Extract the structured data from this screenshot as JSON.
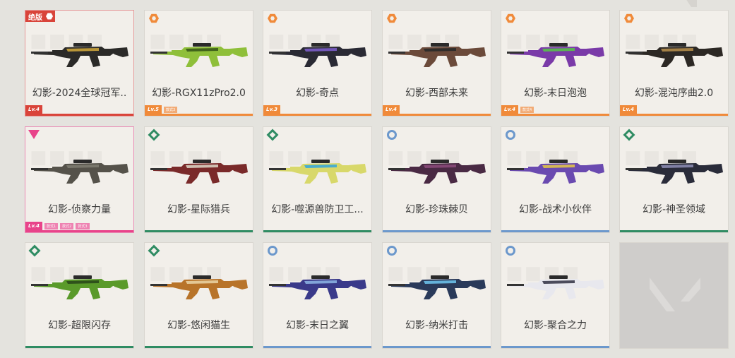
{
  "cards": [
    {
      "name": "幻影-2024全球冠军..",
      "rarity": "red",
      "badge": "red-label",
      "badge_text": "绝版",
      "level": "Lv.4",
      "chips": [],
      "gun_color": "#2b2a28",
      "accent": "#c9a23a"
    },
    {
      "name": "幻影-RGX11zPro2.0",
      "rarity": "orange",
      "badge": "hex",
      "level": "Lv.5",
      "chips": [
        "款式3"
      ],
      "gun_color": "#8fbf3a",
      "accent": "#3a5a1a"
    },
    {
      "name": "幻影-奇点",
      "rarity": "orange",
      "badge": "hex",
      "level": "Lv.3",
      "chips": [],
      "gun_color": "#2a2a34",
      "accent": "#7a5cc6"
    },
    {
      "name": "幻影-西部未来",
      "rarity": "orange",
      "badge": "hex",
      "level": "Lv.4",
      "chips": [],
      "gun_color": "#6b4a3a",
      "accent": "#2a2a2a"
    },
    {
      "name": "幻影-末日泡泡",
      "rarity": "orange",
      "badge": "hex",
      "level": "Lv.4",
      "chips": [
        "款式4"
      ],
      "gun_color": "#7a3aa8",
      "accent": "#58c04a"
    },
    {
      "name": "幻影-混沌序曲2.0",
      "rarity": "orange",
      "badge": "hex",
      "level": "Lv.4",
      "chips": [],
      "gun_color": "#2c2824",
      "accent": "#b08a4a"
    },
    {
      "name": "幻影-侦察力量",
      "rarity": "pink",
      "badge": "tri",
      "level": "Lv.4",
      "chips": [
        "款式1",
        "款式2",
        "款式3"
      ],
      "gun_color": "#55524a",
      "accent": "#7d7b70"
    },
    {
      "name": "幻影-星际猎兵",
      "rarity": "green",
      "badge": "diamond",
      "level": "",
      "chips": [],
      "gun_color": "#7a2a2a",
      "accent": "#d8cfc0"
    },
    {
      "name": "幻影-噬源兽防卫工...",
      "rarity": "green",
      "badge": "diamond",
      "level": "",
      "chips": [],
      "gun_color": "#d8d86a",
      "accent": "#3aa8d8"
    },
    {
      "name": "幻影-珍珠棘贝",
      "rarity": "blue",
      "badge": "circle",
      "level": "",
      "chips": [],
      "gun_color": "#4a2a44",
      "accent": "#8a4a7a"
    },
    {
      "name": "幻影-战术小伙伴",
      "rarity": "blue",
      "badge": "circle",
      "level": "",
      "chips": [],
      "gun_color": "#6a4ab0",
      "accent": "#e0c24a"
    },
    {
      "name": "幻影-神圣领域",
      "rarity": "green",
      "badge": "diamond",
      "level": "",
      "chips": [],
      "gun_color": "#2a2c3a",
      "accent": "#8a8ab0"
    },
    {
      "name": "幻影-超限闪存",
      "rarity": "green",
      "badge": "diamond",
      "level": "",
      "chips": [],
      "gun_color": "#5a9a2a",
      "accent": "#2a4a1a"
    },
    {
      "name": "幻影-悠闲猫生",
      "rarity": "green",
      "badge": "diamond",
      "level": "",
      "chips": [],
      "gun_color": "#b8742a",
      "accent": "#e8d0a0"
    },
    {
      "name": "幻影-末日之翼",
      "rarity": "blue",
      "badge": "circle",
      "level": "",
      "chips": [],
      "gun_color": "#3a3a8a",
      "accent": "#8ab0e0"
    },
    {
      "name": "幻影-纳米打击",
      "rarity": "blue",
      "badge": "circle",
      "level": "",
      "chips": [],
      "gun_color": "#2a3a5a",
      "accent": "#6ac0e8"
    },
    {
      "name": "幻影-聚合之力",
      "rarity": "blue",
      "badge": "circle",
      "level": "",
      "chips": [],
      "gun_color": "#e8e8ee",
      "accent": "#3a3a4a"
    }
  ],
  "colors": {
    "orange": "#f08a3a",
    "green": "#2f8c63",
    "blue": "#6c98cc",
    "pink": "#e8438a",
    "red": "#d9443a"
  }
}
